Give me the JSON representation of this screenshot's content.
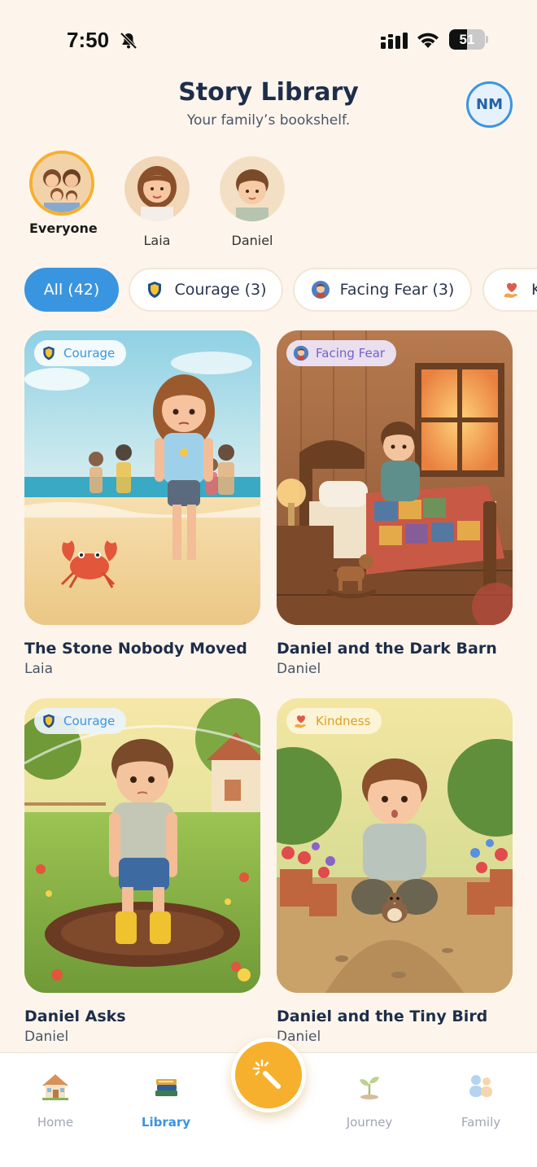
{
  "status_bar": {
    "time": "7:50",
    "battery": "51",
    "battery_level": 0.51
  },
  "header": {
    "title": "Story Library",
    "subtitle": "Your family’s bookshelf.",
    "avatar_initials": "NM"
  },
  "profiles": [
    {
      "name": "Everyone",
      "selected": true
    },
    {
      "name": "Laia",
      "selected": false
    },
    {
      "name": "Daniel",
      "selected": false
    }
  ],
  "filters": [
    {
      "label": "All (42)",
      "active": true,
      "icon": ""
    },
    {
      "label": "Courage (3)",
      "active": false,
      "icon": "shield-icon"
    },
    {
      "label": "Facing Fear (3)",
      "active": false,
      "icon": "boy-badge-icon"
    },
    {
      "label": "K",
      "active": false,
      "icon": "heart-hand-icon"
    }
  ],
  "stories": [
    {
      "title": "The Stone Nobody Moved",
      "author": "Laia",
      "tag": "Courage",
      "tag_icon": "shield-icon"
    },
    {
      "title": "Daniel and the Dark Barn",
      "author": "Daniel",
      "tag": "Facing Fear",
      "tag_icon": "boy-badge-icon"
    },
    {
      "title": "Daniel Asks",
      "author": "Daniel",
      "tag": "Courage",
      "tag_icon": "shield-icon"
    },
    {
      "title": "Daniel and the Tiny Bird",
      "author": "Daniel",
      "tag": "Kindness",
      "tag_icon": "heart-hand-icon"
    }
  ],
  "nav": {
    "items": [
      {
        "label": "Home",
        "icon": "house-icon",
        "active": false
      },
      {
        "label": "Library",
        "icon": "books-icon",
        "active": true
      },
      {
        "label": "Journey",
        "icon": "sprout-icon",
        "active": false
      },
      {
        "label": "Family",
        "icon": "family-icon",
        "active": false
      }
    ],
    "fab_icon": "magic-wand-icon"
  },
  "colors": {
    "accent": "#3a95e0",
    "fab": "#f7b02d",
    "background": "#fdf5ec",
    "title": "#1e2e4a"
  }
}
